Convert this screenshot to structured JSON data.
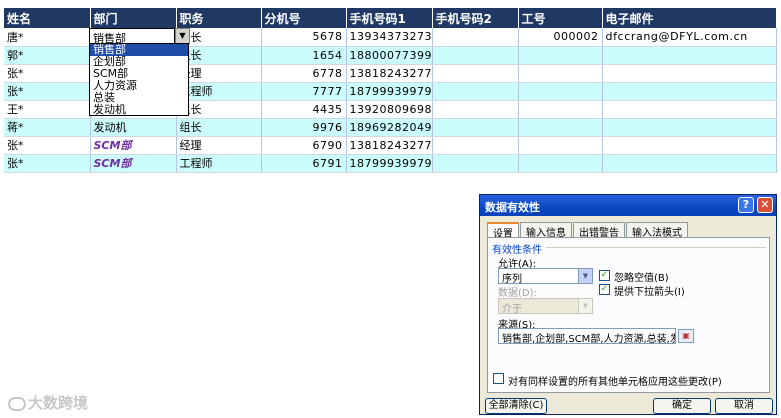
{
  "sheet": {
    "headers": [
      "姓名",
      "部门",
      "职务",
      "分机号",
      "手机号码1",
      "手机号码2",
      "工号",
      "电子邮件"
    ],
    "rows": [
      {
        "name": "唐*",
        "dept": "销售部",
        "title": "组长",
        "ext": "5678",
        "mobile1": "13934373273",
        "mobile2": "",
        "id": "000002",
        "email": "dfccrang@DFYL.com.cn"
      },
      {
        "name": "郭*",
        "dept": "",
        "title": "组长",
        "ext": "1654",
        "mobile1": "18800077399",
        "mobile2": "",
        "id": "",
        "email": ""
      },
      {
        "name": "张*",
        "dept": "",
        "title": "经理",
        "ext": "6778",
        "mobile1": "13818243277",
        "mobile2": "",
        "id": "",
        "email": ""
      },
      {
        "name": "张*",
        "dept": "",
        "title": "工程师",
        "ext": "7777",
        "mobile1": "18799939979",
        "mobile2": "",
        "id": "",
        "email": ""
      },
      {
        "name": "王*",
        "dept": "",
        "title": "组长",
        "ext": "4435",
        "mobile1": "13920809698",
        "mobile2": "",
        "id": "",
        "email": ""
      },
      {
        "name": "蒋*",
        "dept": "发动机",
        "title": "组长",
        "ext": "9976",
        "mobile1": "18969282049",
        "mobile2": "",
        "id": "",
        "email": ""
      },
      {
        "name": "张*",
        "dept": "SCM部",
        "title": "经理",
        "ext": "6790",
        "mobile1": "13818243277",
        "mobile2": "",
        "id": "",
        "email": ""
      },
      {
        "name": "张*",
        "dept": "SCM部",
        "title": "工程师",
        "ext": "6791",
        "mobile1": "18799939979",
        "mobile2": "",
        "id": "",
        "email": ""
      }
    ]
  },
  "dropdown": {
    "current_value": "销售部",
    "options": [
      "销售部",
      "企划部",
      "SCM部",
      "人力资源",
      "总装",
      "发动机"
    ],
    "selected_index": 0
  },
  "watermark": {
    "text": "大数跨境"
  },
  "dialog": {
    "title": "数据有效性",
    "help_glyph": "?",
    "close_glyph": "✕",
    "tabs": [
      "设置",
      "输入信息",
      "出错警告",
      "输入法模式"
    ],
    "active_tab": 0,
    "group_label": "有效性条件",
    "allow_label": "允许(A):",
    "allow_value": "序列",
    "ignore_blank_label": "忽略空值(B)",
    "ignore_blank_checked": true,
    "dropdown_arrow_label": "提供下拉箭头(I)",
    "dropdown_arrow_checked": true,
    "data_label": "数据(D):",
    "data_value": "介于",
    "source_label": "来源(S):",
    "source_value": "销售部,企划部,SCM部,人力资源,总装,发动机",
    "apply_all_label": "对有同样设置的所有其他单元格应用这些更改(P)",
    "apply_all_checked": false,
    "clear_all_label": "全部清除(C)",
    "ok_label": "确定",
    "cancel_label": "取消"
  },
  "colors": {
    "header_bg": "#1f3864",
    "alt_row_bg": "#ccfdfd",
    "scm_text": "#7030a0",
    "selection_bg": "#1f4ea8",
    "titlebar": "#0a4ac4"
  }
}
